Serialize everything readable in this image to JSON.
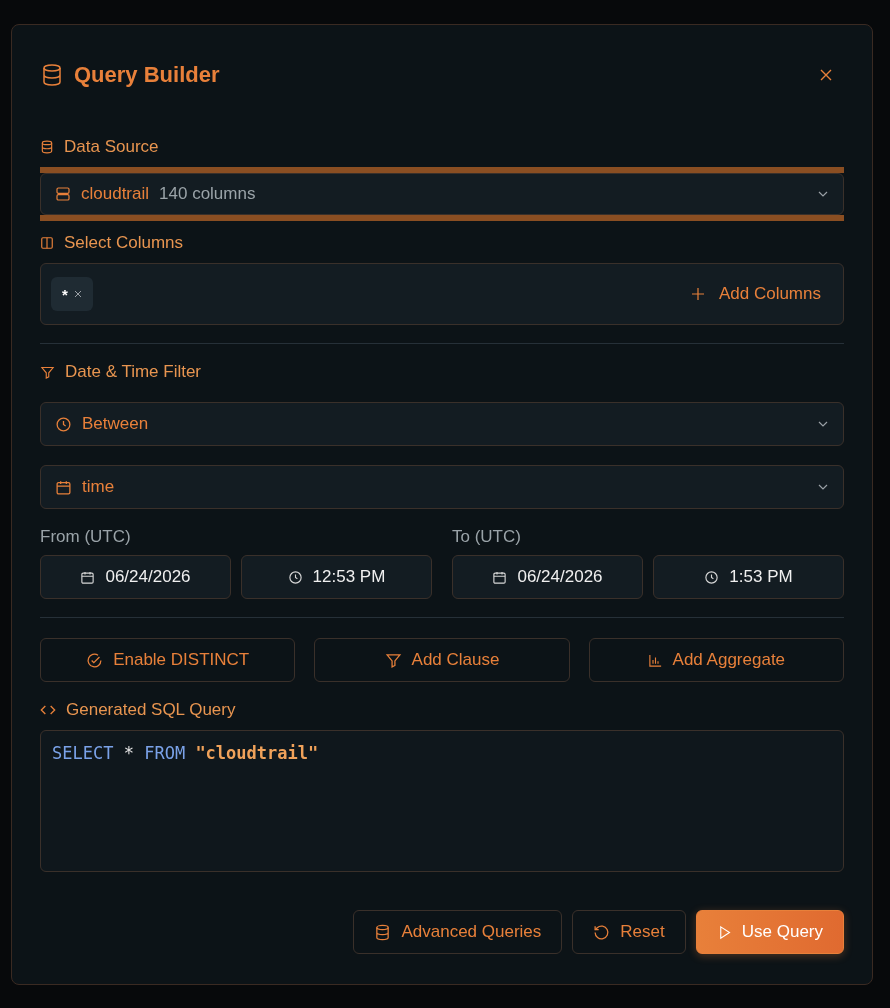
{
  "dialog": {
    "title": "Query Builder"
  },
  "data_source": {
    "label": "Data Source",
    "table": "cloudtrail",
    "columns_count": "140 columns",
    "focused": true
  },
  "select_columns": {
    "label": "Select Columns",
    "chips": [
      "*"
    ],
    "add_button": "Add Columns"
  },
  "date_filter": {
    "label": "Date & Time Filter",
    "operator": "Between",
    "field": "time",
    "ranges": [
      {
        "label": "From (UTC)",
        "date": "06/24/2026",
        "time": "12:53 PM"
      },
      {
        "label": "To (UTC)",
        "date": "06/24/2026",
        "time": "1:53 PM"
      }
    ]
  },
  "actions": [
    {
      "kind": "distinct",
      "label": "Enable DISTINCT"
    },
    {
      "kind": "clause",
      "label": "Add Clause"
    },
    {
      "kind": "aggregate",
      "label": "Add Aggregate"
    }
  ],
  "sql": {
    "label": "Generated SQL Query",
    "tokens": [
      {
        "kind": "keyword",
        "text": "SELECT"
      },
      {
        "kind": "operator",
        "text": "*"
      },
      {
        "kind": "keyword",
        "text": "FROM"
      },
      {
        "kind": "string",
        "text": "\"cloudtrail\""
      }
    ]
  },
  "footer": [
    {
      "kind": "advanced",
      "label": "Advanced Queries",
      "primary": false
    },
    {
      "kind": "reset",
      "label": "Reset",
      "primary": false
    },
    {
      "kind": "use",
      "label": "Use Query",
      "primary": true
    }
  ]
}
